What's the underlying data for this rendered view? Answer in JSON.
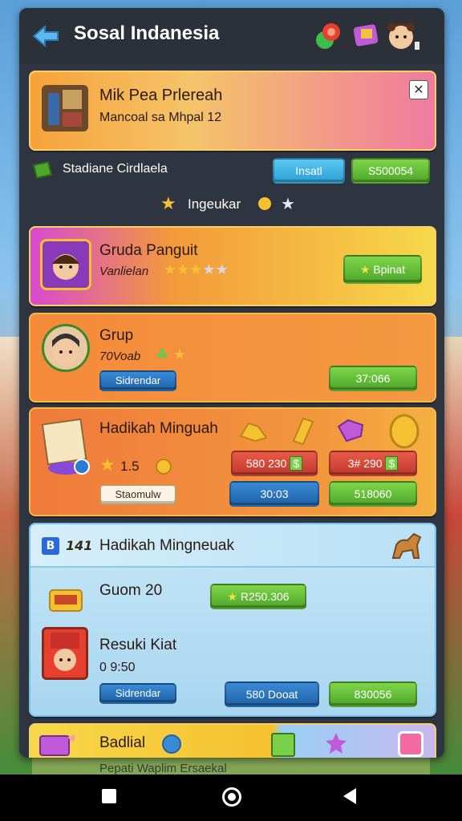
{
  "header": {
    "title": "Sosal Indanesia"
  },
  "notice": {
    "title": "Mik Pea Prlereah",
    "subtitle": "Mancoal sa Mhpal 12"
  },
  "account_row": {
    "label": "Stadiane Cirdlaela",
    "install_label": "Insatl",
    "value": "S500054"
  },
  "level_row": {
    "label": "Ingeukar"
  },
  "card1": {
    "title": "Gruda Panguit",
    "subtitle": "Vanlielan",
    "button": "Bpinat"
  },
  "card2": {
    "title": "Grup",
    "subtitle": "70Voab",
    "tag": "Sidrendar",
    "button": "37:066"
  },
  "card3": {
    "title": "Hadikah Minguah",
    "rating": "1.5",
    "price1": "580 230",
    "price2": "3# 290",
    "tag": "Staomulw",
    "btn_blue": "30:03",
    "btn_green": "518060"
  },
  "card4": {
    "title": "Hadikah Mingneuak",
    "badge": "141",
    "row1_label": "Guom 20",
    "row1_value": "R250.306",
    "row2_label": "Resuki Kiat",
    "row2_sub": "0 9:50",
    "tag": "Sidrendar",
    "btn_blue": "580 Dooat",
    "btn_green": "830056"
  },
  "card5": {
    "title": "Badlial",
    "footer_peek": "Pepati Waplim Ersaekal"
  },
  "colors": {
    "panel": "#2e3440",
    "green": "#4ea62a",
    "orange": "#f0863a",
    "blue": "#1f62a8"
  }
}
